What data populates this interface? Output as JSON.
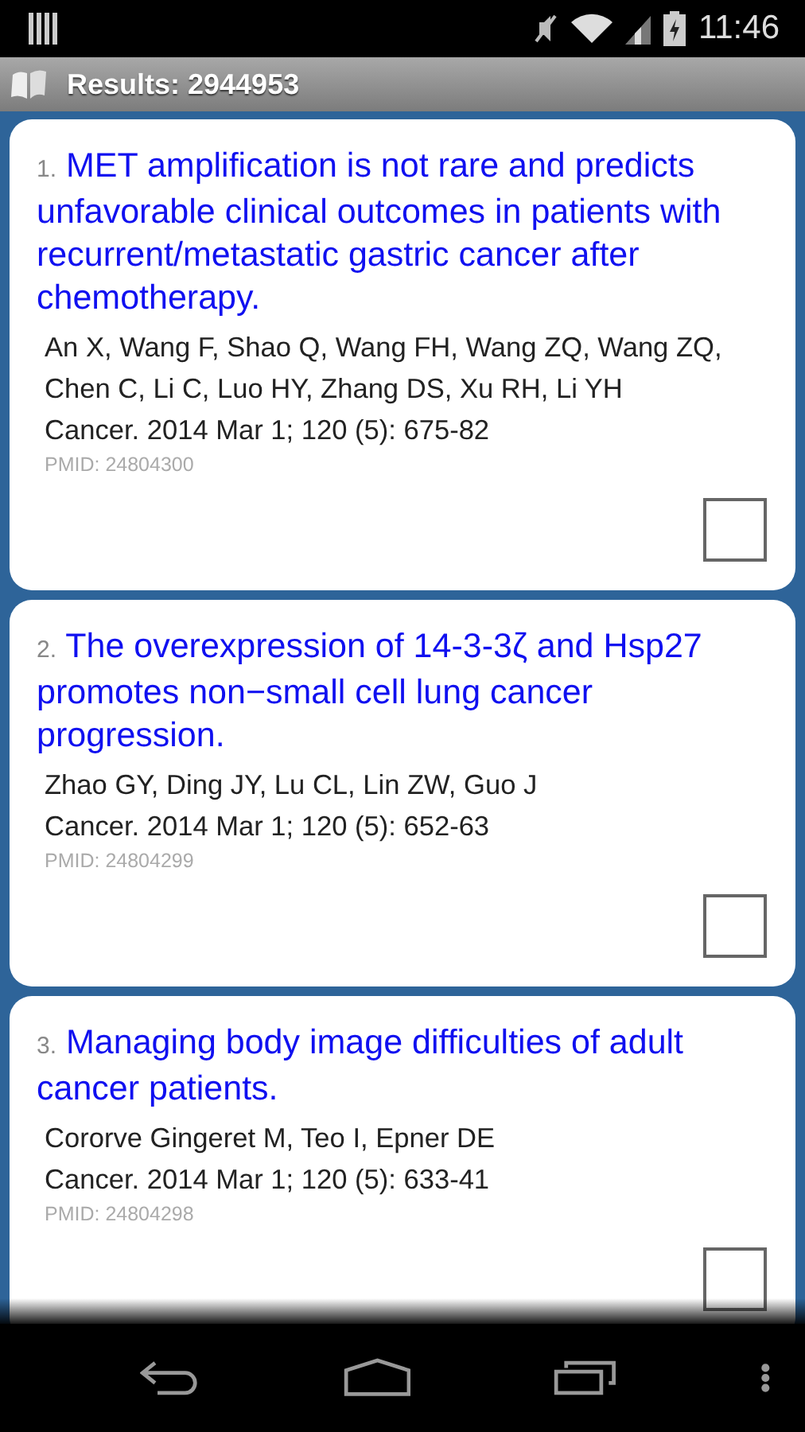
{
  "status_bar": {
    "time": "11:46"
  },
  "action_bar": {
    "title": "Results: 2944953"
  },
  "results": [
    {
      "number": "1.",
      "title": "MET amplification is not rare and predicts unfavorable clinical outcomes in patients with recurrent/metastatic gastric cancer after chemotherapy.",
      "authors": "An X, Wang F, Shao Q, Wang FH, Wang ZQ, Wang ZQ, Chen C, Li C, Luo HY, Zhang DS, Xu RH, Li YH",
      "citation": "Cancer. 2014 Mar 1; 120 (5): 675-82",
      "pmid": "PMID: 24804300",
      "checked": false
    },
    {
      "number": "2.",
      "title": "The overexpression of 14-3-3ζ and Hsp27 promotes non−small cell lung cancer progression.",
      "authors": "Zhao GY, Ding JY, Lu CL, Lin ZW, Guo J",
      "citation": "Cancer. 2014 Mar 1; 120 (5): 652-63",
      "pmid": "PMID: 24804299",
      "checked": false
    },
    {
      "number": "3.",
      "title": "Managing body image difficulties of adult cancer patients.",
      "authors": "Cororve Gingeret M, Teo I, Epner DE",
      "citation": "Cancer. 2014 Mar 1; 120 (5): 633-41",
      "pmid": "PMID: 24804298",
      "checked": false
    }
  ]
}
